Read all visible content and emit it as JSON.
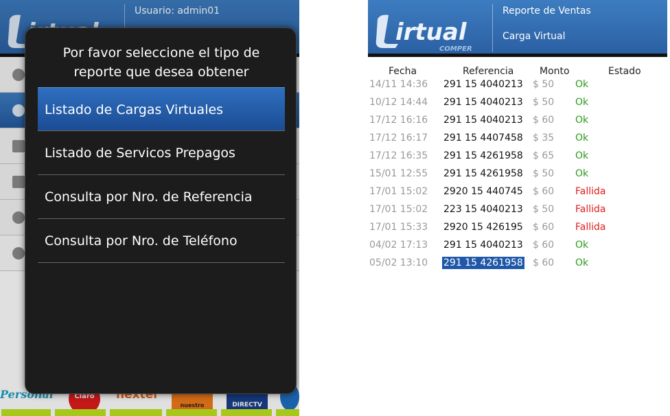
{
  "left": {
    "header": {
      "user_line": "Usuario: admin01"
    },
    "dialog": {
      "prompt_line1": "Por favor seleccione el tipo de",
      "prompt_line2": "reporte que desea obtener",
      "options": [
        {
          "label": "Listado de Cargas Virtuales",
          "selected": true
        },
        {
          "label": "Listado de Servicos Prepagos",
          "selected": false
        },
        {
          "label": "Consulta por Nro. de Referencia",
          "selected": false
        },
        {
          "label": "Consulta por Nro. de Teléfono",
          "selected": false
        }
      ]
    },
    "logos": [
      "Personal",
      "Claro",
      "nextel",
      "nuestro",
      "DIRECTV",
      ""
    ]
  },
  "right": {
    "header": {
      "title": "Reporte de Ventas",
      "subtitle": "Carga Virtual"
    },
    "brand": {
      "word": "irtual",
      "sub": "COMPER"
    },
    "table": {
      "headers": {
        "fecha": "Fecha",
        "referencia": "Referencia",
        "monto": "Monto",
        "estado": "Estado"
      },
      "rows": [
        {
          "fecha": "14/11 14:36",
          "ref": "291 15 4040213",
          "monto": "$ 50",
          "estado": "Ok"
        },
        {
          "fecha": "10/12 14:44",
          "ref": "291 15 4040213",
          "monto": "$ 50",
          "estado": "Ok"
        },
        {
          "fecha": "17/12 16:16",
          "ref": "291 15 4040213",
          "monto": "$ 60",
          "estado": "Ok"
        },
        {
          "fecha": "17/12 16:17",
          "ref": "291 15 4407458",
          "monto": "$ 35",
          "estado": "Ok"
        },
        {
          "fecha": "17/12 16:35",
          "ref": "291 15 4261958",
          "monto": "$ 65",
          "estado": "Ok"
        },
        {
          "fecha": "15/01 12:55",
          "ref": "291 15 4261958",
          "monto": "$ 50",
          "estado": "Ok"
        },
        {
          "fecha": "17/01 15:02",
          "ref": "2920 15 440745",
          "monto": "$ 60",
          "estado": "Fallida"
        },
        {
          "fecha": "17/01 15:02",
          "ref": "223 15 4040213",
          "monto": "$ 50",
          "estado": "Fallida"
        },
        {
          "fecha": "17/01 15:33",
          "ref": "2920 15 426195",
          "monto": "$ 60",
          "estado": "Fallida"
        },
        {
          "fecha": "04/02 17:13",
          "ref": "291 15 4040213",
          "monto": "$ 60",
          "estado": "Ok"
        },
        {
          "fecha": "05/02 13:10",
          "ref": "291 15 4261958",
          "monto": "$ 60",
          "estado": "Ok",
          "highlighted": true
        }
      ]
    }
  },
  "colors": {
    "header_blue": "#2f6cb3",
    "ok": "#2e9a1e",
    "fallida": "#e01b1b",
    "selection": "#1f58a8"
  }
}
